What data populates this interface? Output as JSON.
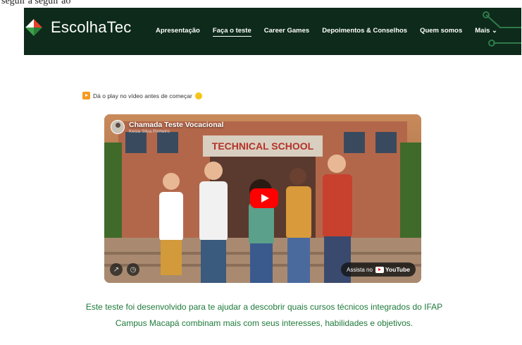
{
  "top_strip": {
    "text": "seguir a seguir ao"
  },
  "nav": {
    "brand": "EscolhaTec",
    "items": [
      {
        "label": "Apresentação",
        "active": false
      },
      {
        "label": "Faça o teste",
        "active": true
      },
      {
        "label": "Career Games",
        "active": false
      },
      {
        "label": "Depoimentos & Conselhos",
        "active": false
      },
      {
        "label": "Quem somos",
        "active": false
      },
      {
        "label": "Mais ⌄",
        "active": false
      }
    ]
  },
  "notice": {
    "text": "Dá o play no vídeo antes de começar"
  },
  "video": {
    "title": "Chamada Teste Vocacional",
    "channel": "Kesia Silva Pinheiro",
    "sign": "TECHNICAL SCHOOL",
    "watch_label": "Assista no",
    "yt_label": "YouTube"
  },
  "intro": {
    "text": "Este teste foi desenvolvido para te ajudar a descobrir quais cursos técnicos integrados do IFAP Campus Macapá combinam mais com seus interesses, habilidades e objetivos."
  },
  "colors": {
    "navbar": "#0d2a1a",
    "accent_green": "#1e7a3a",
    "yt_red": "#ff0000"
  },
  "icons": [
    "brand-logo-icon",
    "play-badge-icon",
    "wink-emoji-icon",
    "share-icon",
    "clock-icon",
    "youtube-logo-icon"
  ]
}
